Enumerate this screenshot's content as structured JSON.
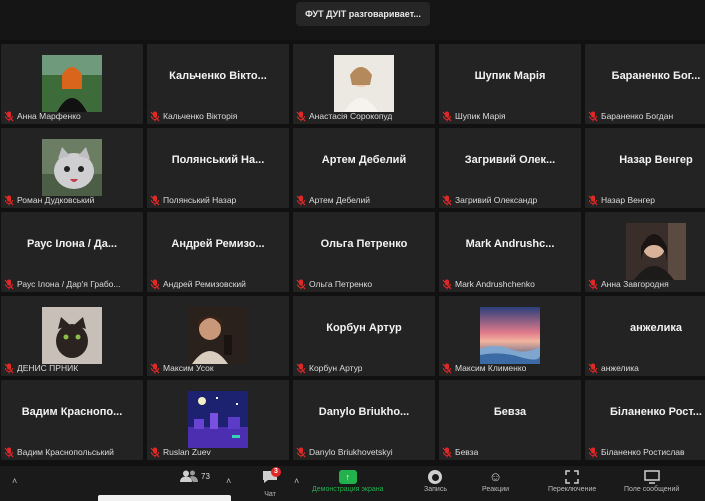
{
  "header": {
    "speaker_text": "ФУТ ДУІТ разговаривает..."
  },
  "participants": [
    {
      "big_name": "",
      "label": "Анна Марфенко",
      "photo": "girl-red-hair"
    },
    {
      "big_name": "Кальченко Вікто...",
      "label": "Кальченко Вікторія"
    },
    {
      "big_name": "",
      "label": "Анастасія Сорокопуд",
      "photo": "woman-light"
    },
    {
      "big_name": "Шупик Марія",
      "label": "Шупик Марія"
    },
    {
      "big_name": "Бараненко Бог...",
      "label": "Бараненко Богдан"
    },
    {
      "big_name": "",
      "label": "Роман Дудковський",
      "photo": "cat-grey"
    },
    {
      "big_name": "Полянський На...",
      "label": "Полянський Назар"
    },
    {
      "big_name": "Артем Дебелий",
      "label": "Артем Дебелий"
    },
    {
      "big_name": "Загривий Олек...",
      "label": "Загривий Олександр"
    },
    {
      "big_name": "Назар Венгер",
      "label": "Назар Венгер"
    },
    {
      "big_name": "Раус Ілона / Да...",
      "label": "Раус Ілона / Дар'я Грабо..."
    },
    {
      "big_name": "Андрей Ремизо...",
      "label": "Андрей Ремизовский"
    },
    {
      "big_name": "Ольга Петренко",
      "label": "Ольга Петренко"
    },
    {
      "big_name": "Mark Andrushc...",
      "label": "Mark Andrushchenko"
    },
    {
      "big_name": "",
      "label": "Анна Завгородня",
      "photo": "woman-dark"
    },
    {
      "big_name": "",
      "label": "ДЕНИС ПРНИК",
      "photo": "kitten"
    },
    {
      "big_name": "",
      "label": "Максим Усок",
      "photo": "person-sepia"
    },
    {
      "big_name": "Корбун Артур",
      "label": "Корбун Артур"
    },
    {
      "big_name": "",
      "label": "Максим Клименко",
      "photo": "seascape"
    },
    {
      "big_name": "анжелика",
      "label": "анжелика"
    },
    {
      "big_name": "Вадим Краснопо...",
      "label": "Вадим Краснопольський"
    },
    {
      "big_name": "",
      "label": "Ruslan Zuev",
      "photo": "pixel-night"
    },
    {
      "big_name": "Danylo Briukho...",
      "label": "Danylo Briukhovetskyi"
    },
    {
      "big_name": "Бевза",
      "label": "Бевза"
    },
    {
      "big_name": "Біланенко Рост...",
      "label": "Біланенко Ростислав"
    }
  ],
  "toolbar": {
    "participants_count": "73",
    "chat_badge": "3",
    "items": [
      "Чат",
      "Демонстрация экрана",
      "Запись",
      "Реакции",
      "Переключение",
      "Поле сообщений"
    ]
  },
  "colors": {
    "tile_bg": "#232323",
    "muted_red": "#e02828",
    "share_green": "#22b14c"
  }
}
